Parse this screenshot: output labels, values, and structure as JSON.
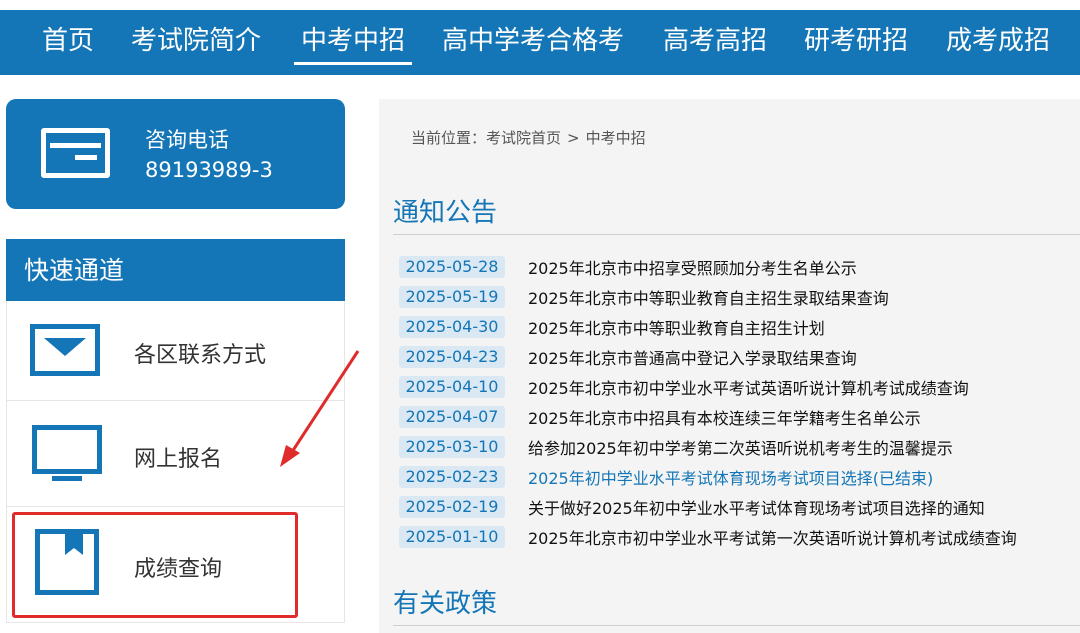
{
  "nav": {
    "items": [
      {
        "label": "首页",
        "active": false
      },
      {
        "label": "考试院简介",
        "active": false
      },
      {
        "label": "中考中招",
        "active": true
      },
      {
        "label": "高中学考合格考",
        "active": false
      },
      {
        "label": "高考高招",
        "active": false
      },
      {
        "label": "研考研招",
        "active": false
      },
      {
        "label": "成考成招",
        "active": false
      }
    ]
  },
  "sidebar": {
    "phone": {
      "label": "咨询电话",
      "number": "89193989-3",
      "icon": "id-card-icon"
    },
    "quick": {
      "title": "快速通道",
      "items": [
        {
          "label": "各区联系方式",
          "icon": "envelope-icon"
        },
        {
          "label": "网上报名",
          "icon": "monitor-icon"
        },
        {
          "label": "成绩查询",
          "icon": "bookmark-icon",
          "highlighted": true
        }
      ]
    }
  },
  "breadcrumb": {
    "prefix": "当前位置：",
    "home": "考试院首页",
    "separator": ">",
    "current": "中考中招"
  },
  "notices": {
    "title": "通知公告",
    "items": [
      {
        "date": "2025-05-28",
        "title": "2025年北京市中招享受照顾加分考生名单公示"
      },
      {
        "date": "2025-05-19",
        "title": "2025年北京市中等职业教育自主招生录取结果查询"
      },
      {
        "date": "2025-04-30",
        "title": "2025年北京市中等职业教育自主招生计划"
      },
      {
        "date": "2025-04-23",
        "title": "2025年北京市普通高中登记入学录取结果查询"
      },
      {
        "date": "2025-04-10",
        "title": "2025年北京市初中学业水平考试英语听说计算机考试成绩查询"
      },
      {
        "date": "2025-04-07",
        "title": "2025年北京市中招具有本校连续三年学籍考生名单公示"
      },
      {
        "date": "2025-03-10",
        "title": "给参加2025年初中学考第二次英语听说机考考生的温馨提示"
      },
      {
        "date": "2025-02-23",
        "title": "2025年初中学业水平考试体育现场考试项目选择(已结束)",
        "link": true
      },
      {
        "date": "2025-02-19",
        "title": "关于做好2025年初中学业水平考试体育现场考试项目选择的通知"
      },
      {
        "date": "2025-01-10",
        "title": "2025年北京市初中学业水平考试第一次英语听说计算机考试成绩查询"
      }
    ]
  },
  "policies": {
    "title": "有关政策"
  },
  "colors": {
    "brand": "#1476b6",
    "highlight": "#e02b2b",
    "date_bg": "#d9e8f3",
    "link": "#1476b6"
  }
}
